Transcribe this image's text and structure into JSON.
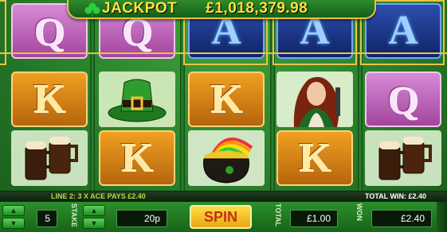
{
  "jackpot": {
    "label": "JACKPOT",
    "value": "£1,018,379.98"
  },
  "reels": [
    [
      "Q",
      "K",
      "beer"
    ],
    [
      "Q",
      "hat",
      "K"
    ],
    [
      "A",
      "K",
      "pot"
    ],
    [
      "A",
      "lady",
      "K"
    ],
    [
      "A",
      "Q",
      "beer"
    ]
  ],
  "status": {
    "line_info": "LINE 2: 3 X ACE PAYS £2.40",
    "total_win": "TOTAL WIN: £2.40"
  },
  "controls": {
    "lines_value": "5",
    "stake_label": "STAKE",
    "stake_value": "20p",
    "spin_label": "SPIN",
    "total_label": "TOTAL",
    "total_value": "£1.00",
    "won_label": "WON",
    "won_value": "£2.40"
  },
  "colors": {
    "gold": "#e9c446",
    "felt": "#2a7f2b",
    "spin": "#f2c12d"
  }
}
